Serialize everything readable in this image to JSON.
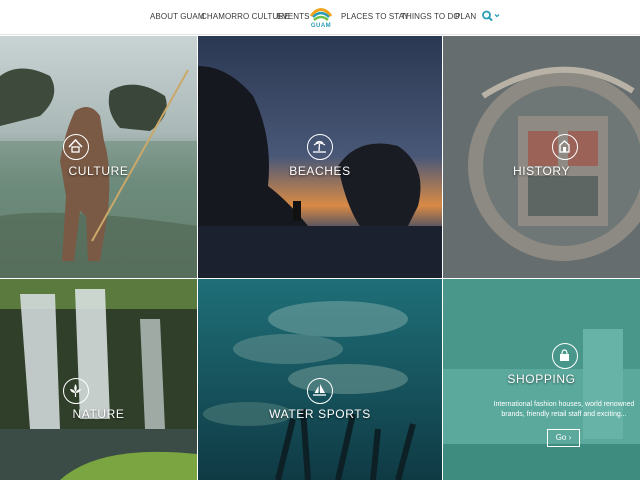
{
  "nav": {
    "items": [
      "ABOUT GUAM",
      "CHAMORRO CULTURE",
      "EVENTS",
      "PLACES TO STAY",
      "THINGS TO DO",
      "PLAN"
    ],
    "logo_text": "GUAM",
    "search_icon": "search-icon",
    "dropdown_icon": "chevron-down-icon"
  },
  "tiles": [
    {
      "label": "CULTURE",
      "icon": "hut-icon"
    },
    {
      "label": "BEACHES",
      "icon": "palm-island-icon"
    },
    {
      "label": "HISTORY",
      "icon": "church-icon"
    },
    {
      "label": "NATURE",
      "icon": "flower-icon"
    },
    {
      "label": "WATER SPORTS",
      "icon": "sailboat-icon"
    },
    {
      "label": "SHOPPING",
      "icon": "shopping-bag-icon"
    }
  ],
  "shopping": {
    "description": "International fashion houses, world renowned brands, friendly retail staff and exciting...",
    "go_label": "Go"
  },
  "colors": {
    "accent": "#2a9db8",
    "shopping_overlay": "#3fb3a5"
  }
}
